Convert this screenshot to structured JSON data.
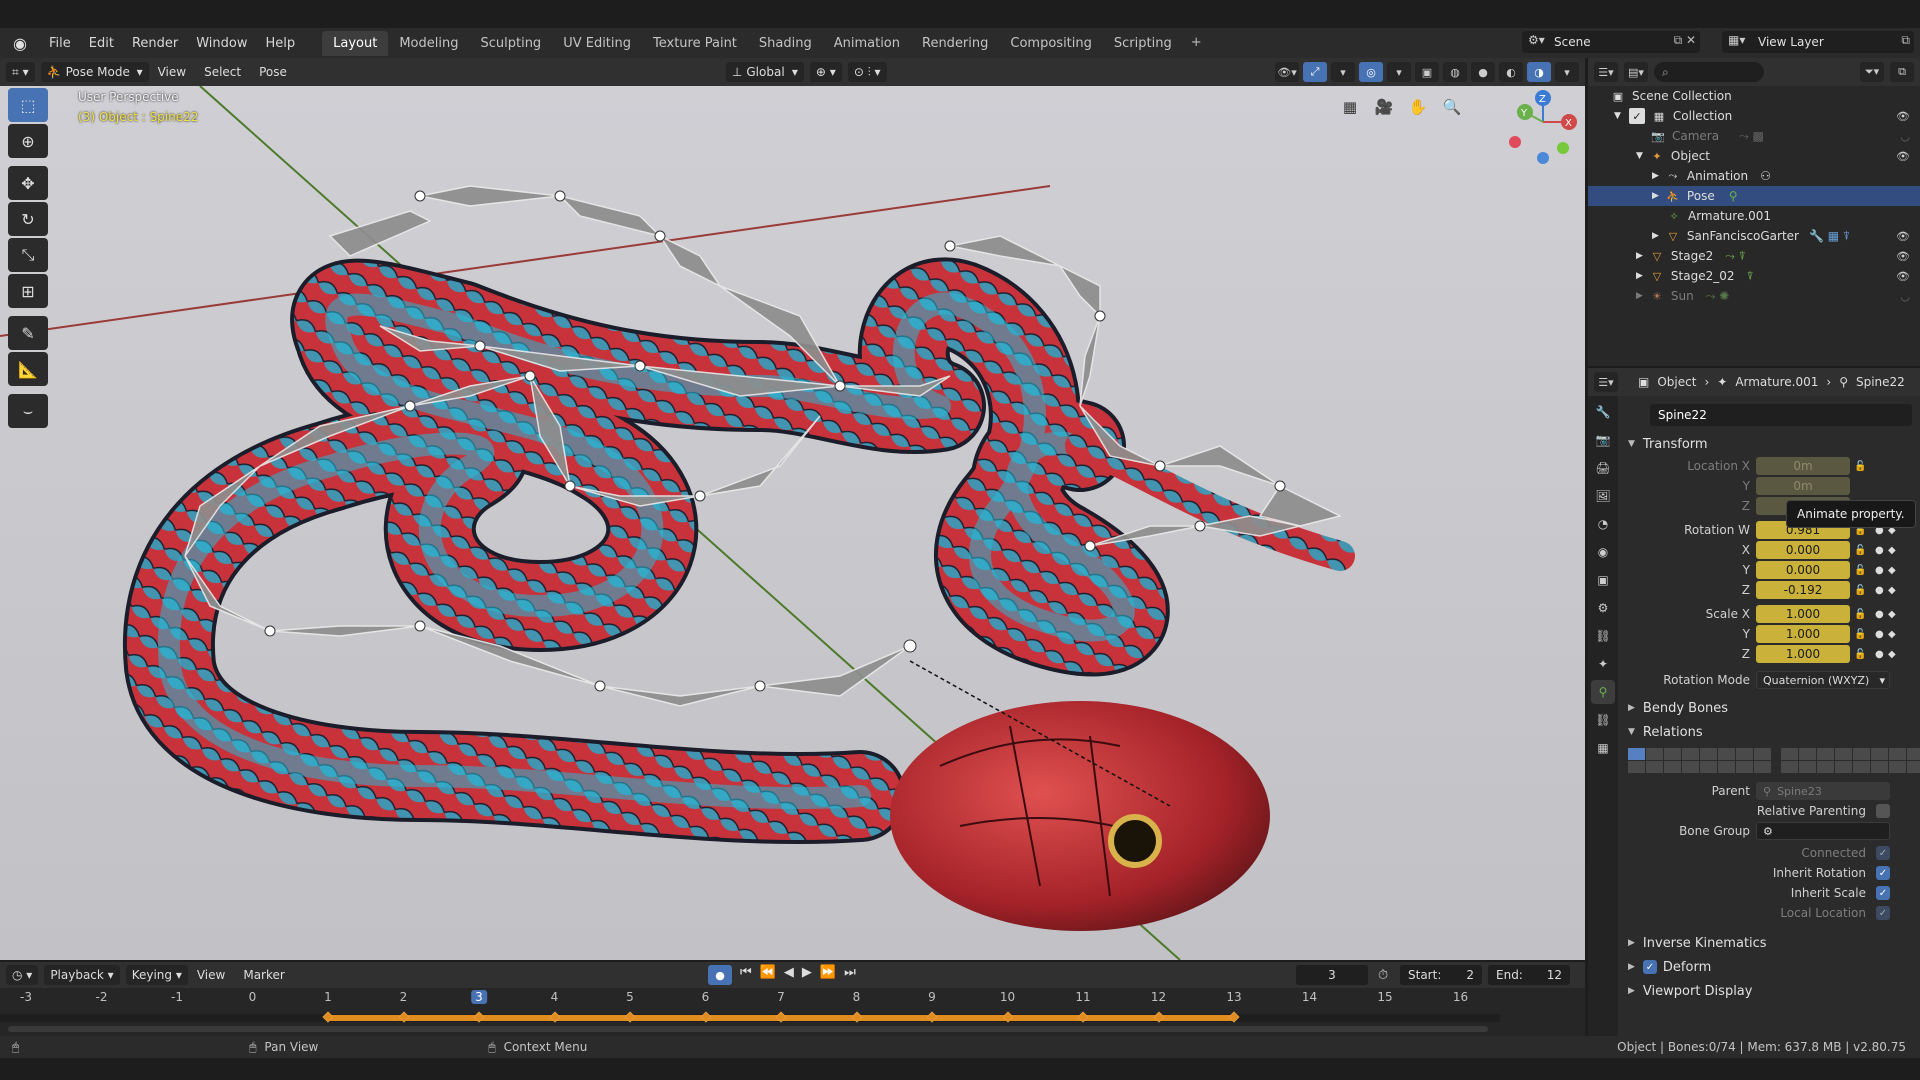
{
  "menu": [
    "File",
    "Edit",
    "Render",
    "Window",
    "Help"
  ],
  "workspaces": [
    "Layout",
    "Modeling",
    "Sculpting",
    "UV Editing",
    "Texture Paint",
    "Shading",
    "Animation",
    "Rendering",
    "Compositing",
    "Scripting"
  ],
  "active_workspace": "Layout",
  "scene": "Scene",
  "view_layer": "View Layer",
  "viewport_header": {
    "mode": "Pose Mode",
    "menus": [
      "View",
      "Select",
      "Pose"
    ],
    "orientation": "Global"
  },
  "viewport": {
    "perspective_label": "User Perspective",
    "object_label": "(3) Object : Spine22",
    "gizmo_axes": {
      "x": "X",
      "y": "Y",
      "z": "Z"
    }
  },
  "timeline": {
    "menus": [
      "Playback",
      "Keying",
      "View",
      "Marker"
    ],
    "current_frame": "3",
    "start_label": "Start:",
    "start": "2",
    "end_label": "End:",
    "end": "12",
    "ticks": [
      "-3",
      "-2",
      "-1",
      "0",
      "1",
      "2",
      "3",
      "4",
      "5",
      "6",
      "7",
      "8",
      "9",
      "10",
      "11",
      "12",
      "13",
      "14",
      "15",
      "16"
    ],
    "keyframes": [
      "1",
      "2",
      "3",
      "4",
      "5",
      "6",
      "7",
      "8",
      "9",
      "10",
      "11",
      "12",
      "13"
    ]
  },
  "statusbar": {
    "pan": "Pan View",
    "context": "Context Menu",
    "info": "Object | Bones:0/74 | Mem: 637.8 MB | v2.80.75"
  },
  "outliner": {
    "rows": [
      {
        "label": "Scene Collection",
        "icon": "scene-collection-icon"
      },
      {
        "label": "Collection",
        "icon": "collection-icon"
      },
      {
        "label": "Camera",
        "icon": "camera-icon"
      },
      {
        "label": "Object",
        "icon": "armature-icon"
      },
      {
        "label": "Animation",
        "icon": "animation-icon"
      },
      {
        "label": "Pose",
        "icon": "pose-icon"
      },
      {
        "label": "Armature.001",
        "icon": "armature-data-icon"
      },
      {
        "label": "SanFanciscoGarter",
        "icon": "mesh-icon"
      },
      {
        "label": "Stage2",
        "icon": "mesh-icon"
      },
      {
        "label": "Stage2_02",
        "icon": "mesh-icon"
      },
      {
        "label": "Sun",
        "icon": "light-icon"
      }
    ]
  },
  "properties": {
    "breadcrumb": [
      "Object",
      "Armature.001",
      "Spine22"
    ],
    "bone_name": "Spine22",
    "transform": {
      "title": "Transform",
      "location_x_label": "Location X",
      "location_x": "0m",
      "location_y_label": "Y",
      "location_y": "0m",
      "location_z_label": "Z",
      "rotation_w_label": "Rotation W",
      "rotation_w": "0.981",
      "rotation_x_label": "X",
      "rotation_x": "0.000",
      "rotation_y_label": "Y",
      "rotation_y": "0.000",
      "rotation_z_label": "Z",
      "rotation_z": "-0.192",
      "scale_x_label": "Scale X",
      "scale_x": "1.000",
      "scale_y_label": "Y",
      "scale_y": "1.000",
      "scale_z_label": "Z",
      "scale_z": "1.000",
      "rotation_mode_label": "Rotation Mode",
      "rotation_mode": "Quaternion (WXYZ)"
    },
    "tooltip": "Animate property.",
    "bendy_bones": "Bendy Bones",
    "relations": {
      "title": "Relations",
      "parent_label": "Parent",
      "parent": "Spine23",
      "relative_parenting": "Relative Parenting",
      "bone_group_label": "Bone Group",
      "connected": "Connected",
      "inherit_rotation": "Inherit Rotation",
      "inherit_scale": "Inherit Scale",
      "local_location": "Local Location"
    },
    "inverse_kinematics": "Inverse Kinematics",
    "deform": "Deform",
    "viewport_display": "Viewport Display"
  }
}
